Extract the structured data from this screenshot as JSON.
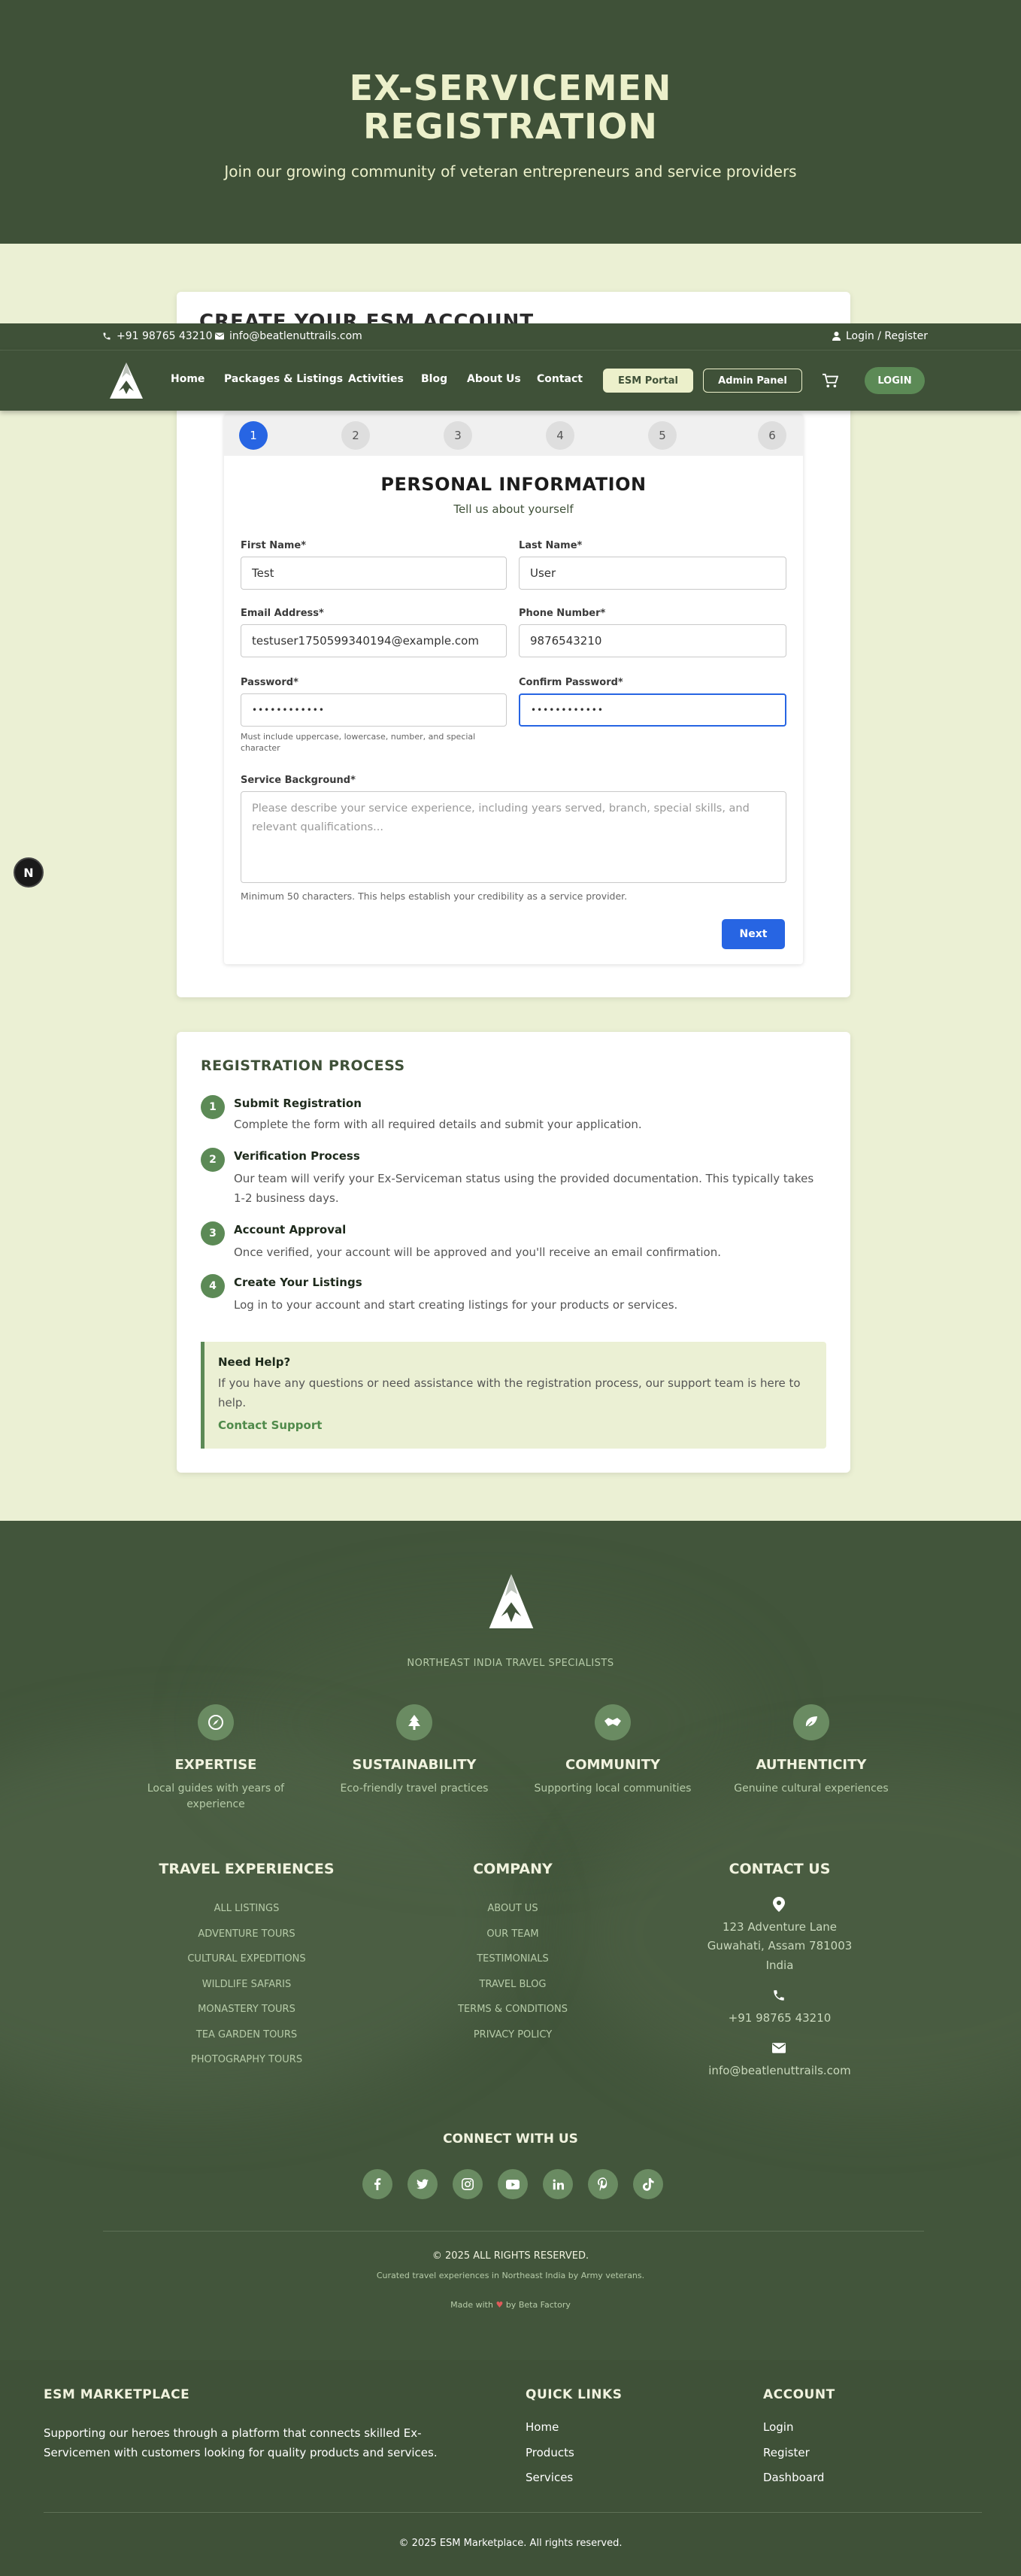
{
  "hero": {
    "title_line1": "EX-SERVICEMEN",
    "title_line2": "REGISTRATION",
    "subtitle": "Join our growing community of veteran entrepreneurs and service providers"
  },
  "topbar": {
    "phone": "+91 98765 43210",
    "email": "info@beatlenuttrails.com",
    "login": "Login / Register"
  },
  "nav": {
    "links": [
      "Home",
      "Packages & Listings",
      "Activities",
      "Blog",
      "About Us",
      "Contact"
    ],
    "esm_portal": "ESM Portal",
    "admin_panel": "Admin Panel",
    "login": "LOGIN"
  },
  "form_card": {
    "hidden_heading": "CREATE YOUR ESM ACCOUNT"
  },
  "stepper": {
    "steps": [
      "1",
      "2",
      "3",
      "4",
      "5",
      "6"
    ],
    "active": 1,
    "active_color": "#2765e3"
  },
  "form": {
    "title": "PERSONAL INFORMATION",
    "subtitle": "Tell us about yourself",
    "first_name": {
      "label": "First Name*",
      "value": "Test"
    },
    "last_name": {
      "label": "Last Name*",
      "value": "User"
    },
    "email": {
      "label": "Email Address*",
      "value": "testuser1750599340194@example.com"
    },
    "phone": {
      "label": "Phone Number*",
      "value": "9876543210"
    },
    "password": {
      "label": "Password*",
      "value": "••••••••••••",
      "hint": "Must include uppercase, lowercase, number, and special character"
    },
    "confirm_password": {
      "label": "Confirm Password*",
      "value": "••••••••••••"
    },
    "service_background": {
      "label": "Service Background*",
      "placeholder": "Please describe your service experience, including years served, branch, special skills, and relevant qualifications...",
      "hint": "Minimum 50 characters. This helps establish your credibility as a service provider."
    },
    "next": "Next"
  },
  "process": {
    "title": "REGISTRATION PROCESS",
    "steps": [
      {
        "num": "1",
        "title": "Submit Registration",
        "desc": "Complete the form with all required details and submit your application."
      },
      {
        "num": "2",
        "title": "Verification Process",
        "desc": "Our team will verify your Ex-Serviceman status using the provided documentation. This typically takes 1-2 business days."
      },
      {
        "num": "3",
        "title": "Account Approval",
        "desc": "Once verified, your account will be approved and you'll receive an email confirmation."
      },
      {
        "num": "4",
        "title": "Create Your Listings",
        "desc": "Log in to your account and start creating listings for your products or services."
      }
    ],
    "help": {
      "title": "Need Help?",
      "text": "If you have any questions or need assistance with the registration process, our support team is here to help.",
      "link": "Contact Support"
    }
  },
  "footer": {
    "tagline": "NORTHEAST INDIA TRAVEL SPECIALISTS",
    "features": [
      {
        "icon": "compass-icon",
        "title": "EXPERTISE",
        "desc": "Local guides with years of experience"
      },
      {
        "icon": "tree-icon",
        "title": "SUSTAINABILITY",
        "desc": "Eco-friendly travel practices"
      },
      {
        "icon": "handshake-icon",
        "title": "COMMUNITY",
        "desc": "Supporting local communities"
      },
      {
        "icon": "leaf-icon",
        "title": "AUTHENTICITY",
        "desc": "Genuine cultural experiences"
      }
    ],
    "travel": {
      "title": "TRAVEL EXPERIENCES",
      "links": [
        "ALL LISTINGS",
        "ADVENTURE TOURS",
        "CULTURAL EXPEDITIONS",
        "WILDLIFE SAFARIS",
        "MONASTERY TOURS",
        "TEA GARDEN TOURS",
        "PHOTOGRAPHY TOURS"
      ]
    },
    "company": {
      "title": "COMPANY",
      "links": [
        "ABOUT US",
        "OUR TEAM",
        "TESTIMONIALS",
        "TRAVEL BLOG",
        "TERMS & CONDITIONS",
        "PRIVACY POLICY"
      ]
    },
    "contact": {
      "title": "CONTACT US",
      "address1": "123 Adventure Lane",
      "address2": "Guwahati, Assam 781003",
      "address3": "India",
      "phone": "+91 98765 43210",
      "email": "info@beatlenuttrails.com"
    },
    "connect_title": "CONNECT WITH US",
    "social": [
      "facebook-icon",
      "twitter-icon",
      "instagram-icon",
      "youtube-icon",
      "linkedin-icon",
      "pinterest-icon",
      "tiktok-icon"
    ],
    "copyright": "© 2025 ALL RIGHTS RESERVED.",
    "curated": "Curated travel experiences in Northeast India by Army veterans.",
    "made_pre": "Made with",
    "made_post": "by Beta Factory"
  },
  "bottom": {
    "brand": "ESM MARKETPLACE",
    "desc_line1": "Supporting our heroes through a platform that connects skilled Ex-",
    "desc_line2": "Servicemen with customers looking for quality products and services.",
    "quick_title": "QUICK LINKS",
    "quick": [
      "Home",
      "Products",
      "Services"
    ],
    "account_title": "ACCOUNT",
    "account": [
      "Login",
      "Register",
      "Dashboard"
    ],
    "copyright": "© 2025 ESM Marketplace. All rights reserved."
  },
  "devtools": {
    "label": "N"
  }
}
